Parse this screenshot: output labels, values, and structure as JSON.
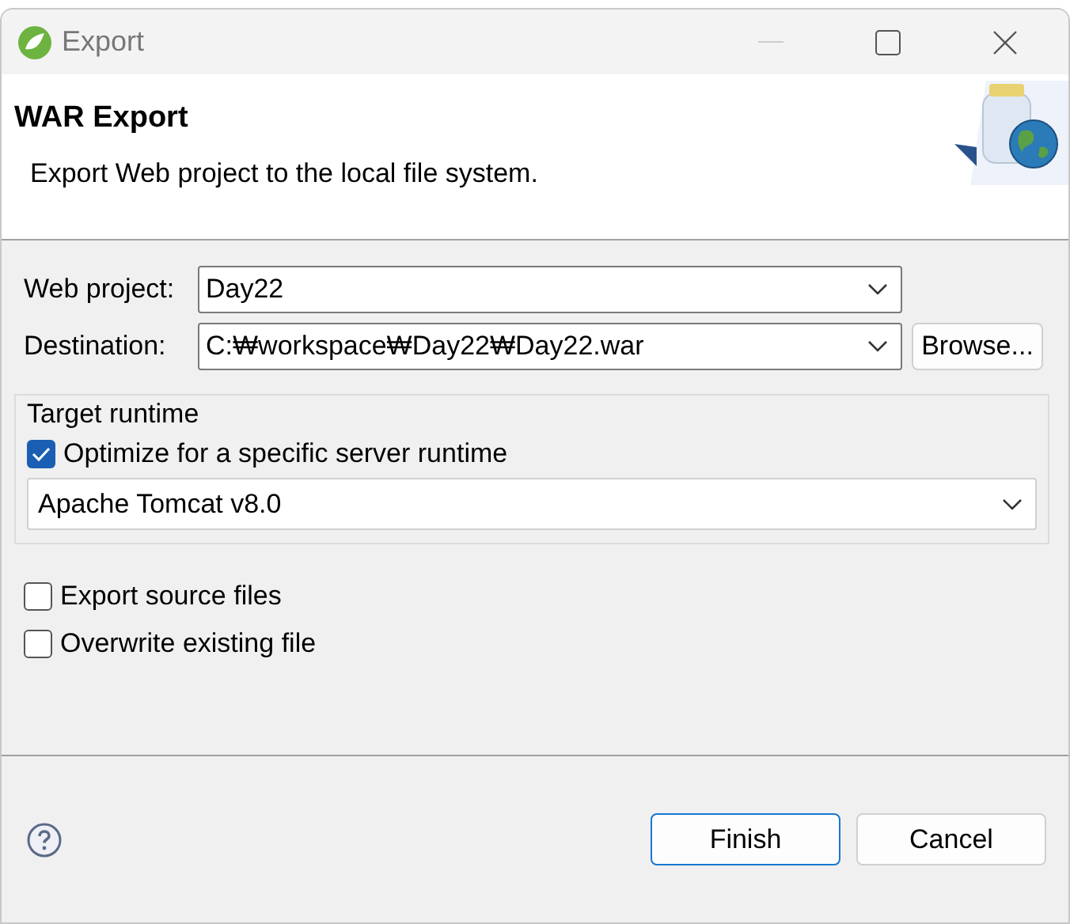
{
  "window": {
    "title": "Export"
  },
  "header": {
    "title": "WAR Export",
    "description": "Export Web project to the local file system."
  },
  "fields": [
    {
      "label": "Web project:",
      "value": "Day22"
    },
    {
      "label": "Destination:",
      "value": "C:₩workspace₩Day22₩Day22.war",
      "browse": "Browse..."
    }
  ],
  "target_runtime": {
    "title": "Target runtime",
    "option": {
      "label": "Optimize for a specific server runtime",
      "checked": true
    },
    "runtime": "Apache Tomcat v8.0"
  },
  "options": [
    {
      "label": "Export source files",
      "checked": false
    },
    {
      "label": "Overwrite existing file",
      "checked": false
    }
  ],
  "buttons": [
    {
      "label": "Finish",
      "default": true
    },
    {
      "label": "Cancel",
      "default": false
    }
  ]
}
